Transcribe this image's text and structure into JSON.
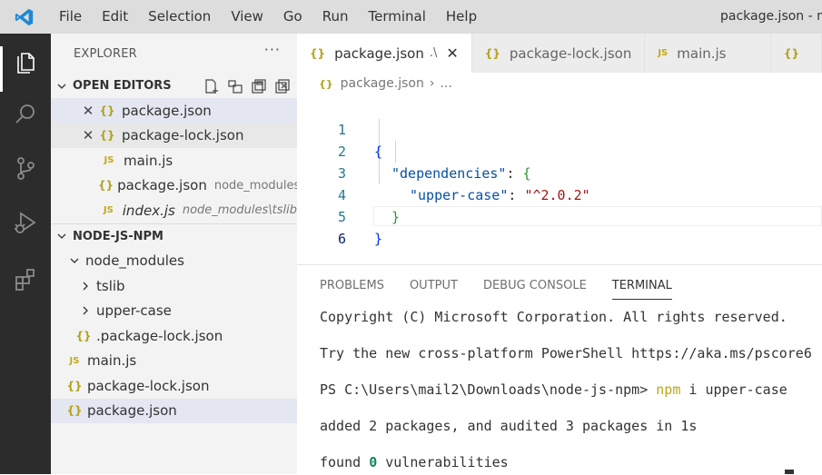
{
  "menu": [
    "File",
    "Edit",
    "Selection",
    "View",
    "Go",
    "Run",
    "Terminal",
    "Help"
  ],
  "window_title": "package.json - node-js-npm",
  "sidebar": {
    "title": "EXPLORER",
    "more": "···",
    "open_editors": {
      "label": "OPEN EDITORS",
      "items": [
        {
          "icon": "{}",
          "name": "package.json",
          "desc": ""
        },
        {
          "icon": "{}",
          "name": "package-lock.json",
          "desc": ""
        },
        {
          "icon": "JS",
          "name": "main.js",
          "desc": ""
        },
        {
          "icon": "{}",
          "name": "package.json",
          "desc": "node_modules\\upper-case"
        },
        {
          "icon": "JS",
          "name": "index.js",
          "desc": "node_modules\\tslib"
        }
      ]
    },
    "project": {
      "label": "NODE-JS-NPM",
      "items": [
        {
          "name": "node_modules"
        },
        {
          "name": "tslib"
        },
        {
          "name": "upper-case"
        },
        {
          "icon": "{}",
          "name": ".package-lock.json"
        },
        {
          "icon": "JS",
          "name": "main.js"
        },
        {
          "icon": "{}",
          "name": "package-lock.json"
        },
        {
          "icon": "{}",
          "name": "package.json"
        }
      ]
    }
  },
  "tabs": [
    {
      "icon": "{}",
      "label": "package.json",
      "suffix": ".\\",
      "close": "✕"
    },
    {
      "icon": "{}",
      "label": "package-lock.json"
    },
    {
      "icon": "JS",
      "label": "main.js"
    },
    {
      "icon": "{}",
      "label": ""
    }
  ],
  "breadcrumb": {
    "file": "package.json",
    "sep": "›",
    "more": "..."
  },
  "code": {
    "line_numbers": [
      "1",
      "2",
      "3",
      "4",
      "5",
      "6"
    ],
    "open_brace": "{",
    "dep_key": "\"dependencies\"",
    "colon": ": ",
    "dep_brace": "{",
    "pkg_key": "\"upper-case\"",
    "pkg_colon": ": ",
    "pkg_value": "\"^2.0.2\"",
    "inner_close": "}",
    "outer_close": "}"
  },
  "panel": {
    "tabs": [
      "PROBLEMS",
      "OUTPUT",
      "DEBUG CONSOLE",
      "TERMINAL"
    ],
    "terminal": {
      "copyright": "Copyright (C) Microsoft Corporation. All rights reserved.",
      "try_line": "Try the new cross-platform PowerShell https://aka.ms/pscore6",
      "prompt": "PS C:\\Users\\mail2\\Downloads\\node-js-npm> ",
      "cmd_npm": "npm",
      "cmd_rest": " i upper-case",
      "added": "added 2 packages, and audited 3 packages in 1s",
      "found_prefix": "found ",
      "found_count": "0",
      "found_suffix": " vulnerabilities"
    }
  },
  "colors": {
    "accent_blue": "#007acc",
    "activity_bar": "#2c2c2c",
    "json_icon": "#b3a21b"
  }
}
